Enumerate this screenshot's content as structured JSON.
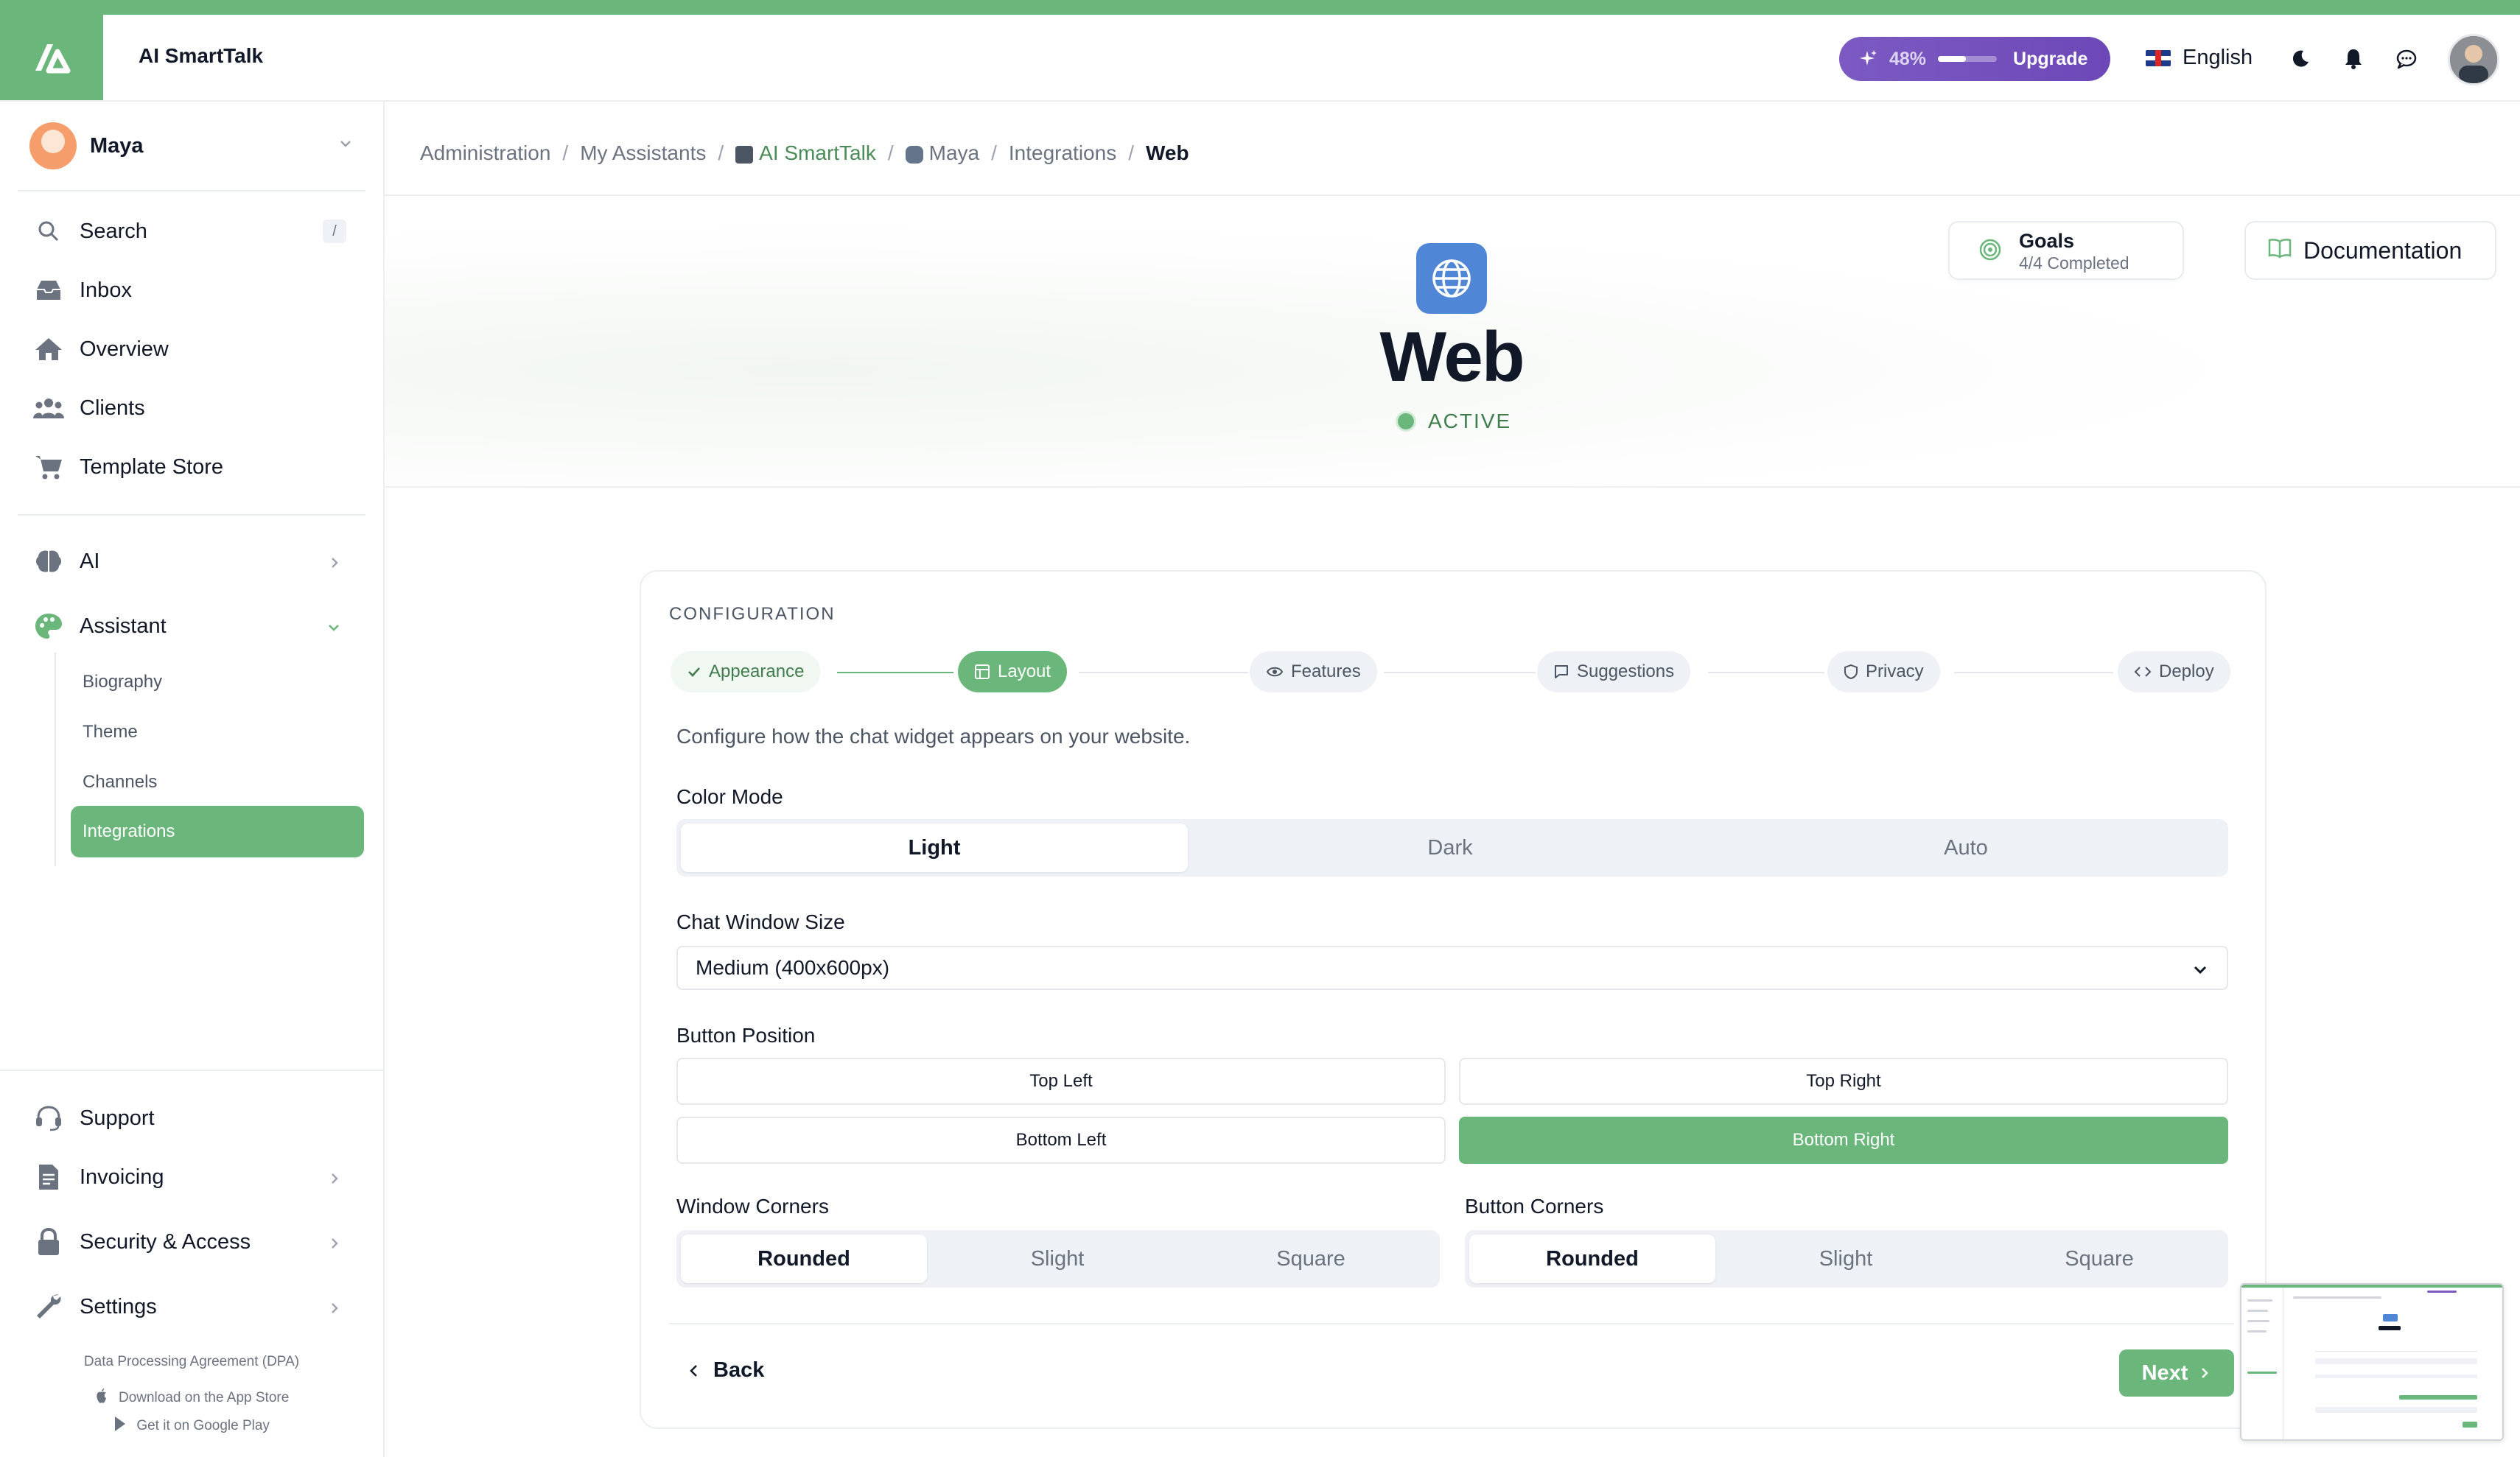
{
  "app": {
    "title": "AI SmartTalk"
  },
  "header": {
    "upgrade": {
      "percent_label": "48%",
      "progress": 0.48,
      "label": "Upgrade"
    },
    "language": "English",
    "icons": [
      "sparkle-icon",
      "moon-icon",
      "bell-icon",
      "chat-icon",
      "user-avatar"
    ]
  },
  "sidebar": {
    "user_name": "Maya",
    "search": {
      "label": "Search",
      "shortcut": "/"
    },
    "items": [
      {
        "label": "Inbox",
        "icon": "inbox-icon"
      },
      {
        "label": "Overview",
        "icon": "home-icon"
      },
      {
        "label": "Clients",
        "icon": "users-icon"
      },
      {
        "label": "Template Store",
        "icon": "cart-icon"
      }
    ],
    "groups": [
      {
        "label": "AI",
        "icon": "brain-icon"
      },
      {
        "label": "Assistant",
        "icon": "palette-icon"
      }
    ],
    "assistant_sub": [
      "Biography",
      "Theme",
      "Channels",
      "Integrations"
    ],
    "active_sub": "Integrations",
    "bottom_items": [
      {
        "label": "Support",
        "icon": "headset-icon"
      },
      {
        "label": "Invoicing",
        "icon": "invoice-icon"
      },
      {
        "label": "Security & Access",
        "icon": "lock-icon"
      },
      {
        "label": "Settings",
        "icon": "wrench-icon"
      }
    ],
    "footer": {
      "dpa": "Data Processing Agreement (DPA)",
      "app_store": "Download on the App Store",
      "google_play": "Get it on Google Play"
    }
  },
  "breadcrumb": {
    "items": [
      "Administration",
      "My Assistants",
      "AI SmartTalk",
      "Maya",
      "Integrations"
    ],
    "current": "Web"
  },
  "hero": {
    "title": "Web",
    "status": "ACTIVE",
    "goals_title": "Goals",
    "goals_sub": "4/4 Completed",
    "docs_label": "Documentation"
  },
  "config": {
    "section_title": "CONFIGURATION",
    "steps": [
      {
        "label": "Appearance",
        "state": "done"
      },
      {
        "label": "Layout",
        "state": "active"
      },
      {
        "label": "Features",
        "state": "todo"
      },
      {
        "label": "Suggestions",
        "state": "todo"
      },
      {
        "label": "Privacy",
        "state": "todo"
      },
      {
        "label": "Deploy",
        "state": "todo"
      }
    ],
    "description": "Configure how the chat widget appears on your website.",
    "color_mode": {
      "label": "Color Mode",
      "options": [
        "Light",
        "Dark",
        "Auto"
      ],
      "selected": "Light"
    },
    "window_size": {
      "label": "Chat Window Size",
      "value": "Medium (400x600px)"
    },
    "button_position": {
      "label": "Button Position",
      "options": [
        "Top Left",
        "Top Right",
        "Bottom Left",
        "Bottom Right"
      ],
      "selected": "Bottom Right"
    },
    "window_corners": {
      "label": "Window Corners",
      "options": [
        "Rounded",
        "Slight",
        "Square"
      ],
      "selected": "Rounded"
    },
    "button_corners": {
      "label": "Button Corners",
      "options": [
        "Rounded",
        "Slight",
        "Square"
      ],
      "selected": "Rounded"
    },
    "back_label": "Back",
    "next_label": "Next"
  },
  "colors": {
    "accent": "#6bb77b",
    "upgrade": "#7c5ac2",
    "web_icon": "#4f86d6"
  }
}
